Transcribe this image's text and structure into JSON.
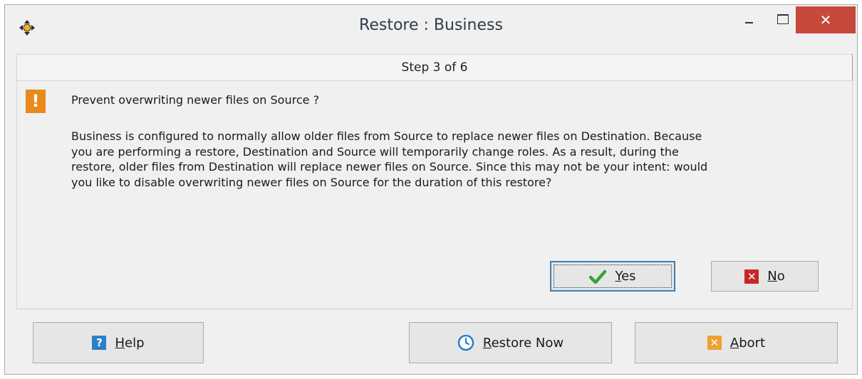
{
  "window": {
    "title": "Restore : Business",
    "close_glyph": "✕"
  },
  "step": {
    "label": "Step 3 of 6"
  },
  "dialog": {
    "question": "Prevent overwriting newer files on Source ?",
    "lines": [
      "Business is configured to normally allow older files from Source to replace newer files on Destination. Because",
      "you are performing a restore, Destination and Source will temporarily change roles. As a result, during the",
      "restore, older files from Destination will replace newer files on Source. Since this may not be your intent: would",
      "you like to disable overwriting newer files on Source for the duration of this restore?"
    ],
    "warning_glyph": "!"
  },
  "buttons": {
    "yes": {
      "accel": "Y",
      "rest": "es"
    },
    "no": {
      "accel": "N",
      "rest": "o"
    },
    "help": {
      "accel": "H",
      "rest": "elp"
    },
    "restore": {
      "accel": "R",
      "rest": "estore Now"
    },
    "abort": {
      "accel": "A",
      "rest": "bort"
    }
  },
  "icons": {
    "app": "move-arrows-icon",
    "yes": "checkmark-icon",
    "no": "red-x-icon",
    "help": "question-icon",
    "restore": "clock-icon",
    "abort": "orange-x-icon"
  },
  "colors": {
    "close": "#c7493c",
    "check": "#3aa235",
    "no": "#c62828",
    "help": "#2c7fc9",
    "abort": "#f0a030",
    "warning": "#e8891c"
  }
}
